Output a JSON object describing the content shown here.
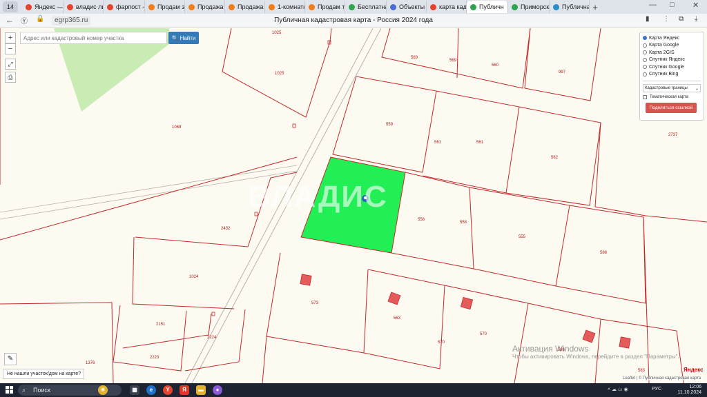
{
  "browser": {
    "tab_counter": "14",
    "tabs": [
      {
        "label": "Яндекс — б",
        "icon": "yandex-icon",
        "color": "#e5432d"
      },
      {
        "label": "владис ли",
        "icon": "yandex-icon",
        "color": "#e5432d"
      },
      {
        "label": "фарпост —",
        "icon": "yandex-icon",
        "color": "#e5432d"
      },
      {
        "label": "Продам зе",
        "icon": "farpost-icon",
        "color": "#f07c1a"
      },
      {
        "label": "Продажа к",
        "icon": "farpost-icon",
        "color": "#f07c1a"
      },
      {
        "label": "Продажа к",
        "icon": "farpost-icon",
        "color": "#f07c1a"
      },
      {
        "label": "1-комнатн",
        "icon": "farpost-icon",
        "color": "#f07c1a"
      },
      {
        "label": "Продам тр",
        "icon": "farpost-icon",
        "color": "#f07c1a"
      },
      {
        "label": "Бесплатна",
        "icon": "green-check-icon",
        "color": "#2ea44f"
      },
      {
        "label": "Объекты",
        "icon": "doc-icon",
        "color": "#4a6fd1"
      },
      {
        "label": "карта када",
        "icon": "yandex-icon",
        "color": "#e5432d"
      },
      {
        "label": "Публичн",
        "icon": "green-check-icon",
        "color": "#2ea44f",
        "active": true
      },
      {
        "label": "Приморск",
        "icon": "green-check-icon",
        "color": "#2ea44f"
      },
      {
        "label": "Публичная",
        "icon": "map-icon",
        "color": "#2a8fc7"
      }
    ],
    "url": "egrp365.ru",
    "page_title": "Публичная кадастровая карта - Россия 2024 года"
  },
  "map": {
    "search_placeholder": "Адрес или кадастровый номер участка",
    "search_button": "Найти",
    "zoom_in": "+",
    "zoom_out": "−",
    "layers": {
      "options": [
        {
          "label": "Карта Яндекс",
          "selected": true
        },
        {
          "label": "Карта Google",
          "selected": false
        },
        {
          "label": "Карта 2GIS",
          "selected": false
        },
        {
          "label": "Спутник Яндекс",
          "selected": false
        },
        {
          "label": "Спутник Google",
          "selected": false
        },
        {
          "label": "Спутник Bing",
          "selected": false
        }
      ],
      "overlay_select": "Кадастровые границы",
      "thematic_label": "Тематическая карта",
      "share_button": "Поделиться ссылкой"
    },
    "parcel_numbers": [
      "1025",
      "1025",
      "569",
      "569",
      "560",
      "997",
      "1069",
      "559",
      "561",
      "561",
      "562",
      "2737",
      "558",
      "558",
      "555",
      "588",
      "2432",
      "1024",
      "573",
      "563",
      "570",
      "570",
      "2151",
      "2224",
      "2223",
      "1376",
      "586",
      "583"
    ],
    "watermark": "ВЛАДИС",
    "activation_title": "Активация Windows",
    "activation_text": "Чтобы активировать Windows, перейдите в раздел \"Параметры\".",
    "not_found_link": "Не нашли участок/дом на карте?",
    "attribution": "Leaflet | © Публичная кадастровая карта",
    "yandex_logo": "Яндекс"
  },
  "taskbar": {
    "search_label": "Поиск",
    "lang": "РУС",
    "time": "12:06",
    "date": "11.10.2024"
  },
  "colors": {
    "highlight_parcel": "#22ee55",
    "parcel_border": "#c22a2a",
    "forest": "#c8ecb4"
  }
}
